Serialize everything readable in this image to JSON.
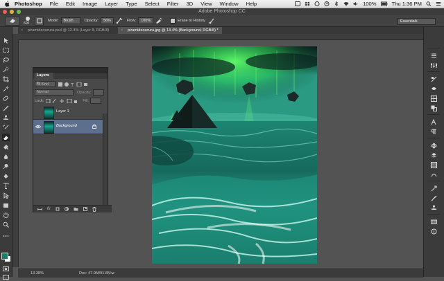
{
  "menubar": {
    "app_name": "Photoshop",
    "items": [
      "File",
      "Edit",
      "Image",
      "Layer",
      "Type",
      "Select",
      "Filter",
      "3D",
      "View",
      "Window",
      "Help"
    ],
    "battery": "100%",
    "clock": "Thu 1:36 PM"
  },
  "window": {
    "title": "Adobe Photoshop CC"
  },
  "options": {
    "brush_size": "600",
    "mode_label": "Mode:",
    "mode_value": "Brush",
    "opacity_label": "Opacity:",
    "opacity_value": "56%",
    "flow_label": "Flow:",
    "flow_value": "100%",
    "erase_history_label": "Erase to History",
    "workspace": "Essentials"
  },
  "tabs": [
    {
      "label": "piramideoscura.psd @ 12.3% (Layer 8, RGB/8)"
    },
    {
      "label": "piramideoscura.jpg @ 13.4% (Background, RGB/8) *"
    }
  ],
  "layers_panel": {
    "title": "Layers",
    "filter_kind": "Kind",
    "blend_mode": "Normal",
    "opacity_label": "Opacity:",
    "lock_label": "Lock:",
    "fill_label": "Fill:",
    "layers": [
      {
        "name": "Layer 1",
        "visible": false,
        "selected": false
      },
      {
        "name": "Background",
        "visible": true,
        "selected": true
      }
    ]
  },
  "status": {
    "zoom": "13.38%",
    "doc": "Doc: 47.9M/91.8M"
  },
  "colors": {
    "foreground": "#1d7b6a",
    "background": "#ffffff",
    "accent_selection": "#5c6f8c"
  },
  "icons": {
    "tools": [
      "move-icon",
      "marquee-icon",
      "lasso-icon",
      "quick-select-icon",
      "crop-icon",
      "eyedropper-icon",
      "healing-icon",
      "brush-icon",
      "clone-stamp-icon",
      "history-brush-icon",
      "eraser-icon",
      "gradient-icon",
      "blur-icon",
      "dodge-icon",
      "pen-icon",
      "type-icon",
      "path-select-icon",
      "shape-icon",
      "hand-icon",
      "zoom-icon"
    ],
    "dock": [
      "history-icon",
      "properties-icon",
      "adjustments-icon",
      "styles-icon",
      "swatches-icon",
      "color-icon",
      "character-icon",
      "paragraph-icon",
      "3d-icon",
      "layers-icon",
      "channels-icon",
      "paths-icon",
      "tool-presets-icon",
      "brushes-icon",
      "clone-source-icon",
      "timeline-icon"
    ]
  }
}
